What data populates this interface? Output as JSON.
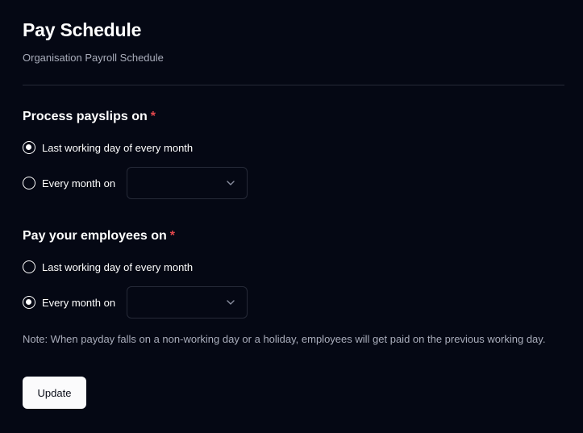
{
  "header": {
    "title": "Pay Schedule",
    "subtitle": "Organisation Payroll Schedule"
  },
  "process_payslips": {
    "heading": "Process payslips on",
    "required_mark": "*",
    "options": [
      {
        "label": "Last working day of every month",
        "selected": true
      },
      {
        "label": "Every month on",
        "selected": false
      }
    ],
    "day_select": {
      "value": "",
      "icon": "chevron-down-icon"
    }
  },
  "pay_employees": {
    "heading": "Pay your employees on",
    "required_mark": "*",
    "options": [
      {
        "label": "Last working day of every month",
        "selected": false
      },
      {
        "label": "Every month on",
        "selected": true
      }
    ],
    "day_select": {
      "value": "",
      "icon": "chevron-down-icon"
    }
  },
  "note": "Note: When payday falls on a non-working day or a holiday, employees will get paid on the previous working day.",
  "actions": {
    "update_label": "Update"
  },
  "colors": {
    "background": "#050814",
    "required": "#e5484d",
    "muted_text": "#a9adbb",
    "border": "#262a38"
  }
}
